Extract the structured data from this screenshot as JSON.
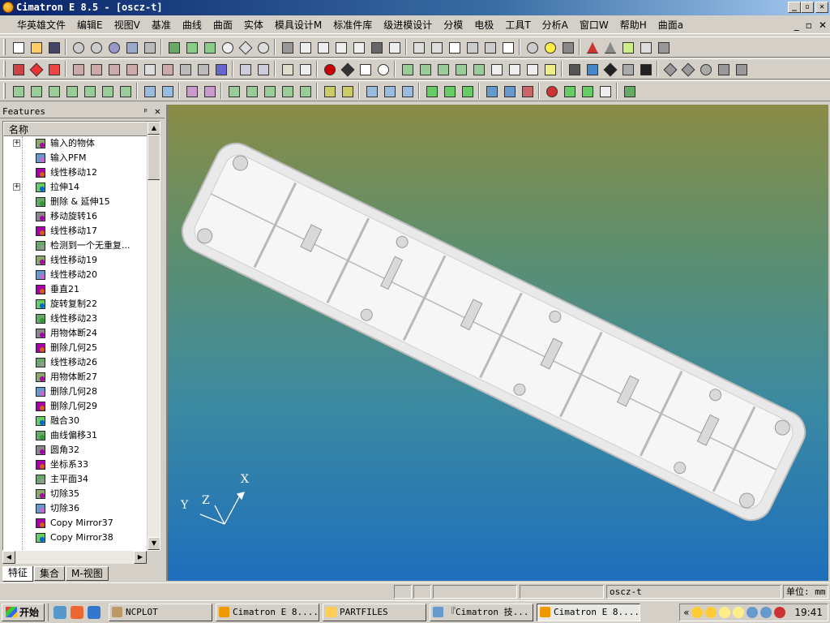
{
  "window": {
    "title": "Cimatron E 8.5 - [oscz-t]",
    "controls": [
      "_",
      "▫",
      "✕"
    ]
  },
  "menu": {
    "items": [
      "华英雄文件",
      "编辑E",
      "视图V",
      "基准",
      "曲线",
      "曲面",
      "实体",
      "模具设计M",
      "标准件库",
      "级进模设计",
      "分模",
      "电极",
      "工具T",
      "分析A",
      "窗口W",
      "帮助H",
      "曲面a"
    ],
    "mdi_controls": [
      "_",
      "▫",
      "✕"
    ]
  },
  "panel": {
    "title": "Features",
    "pin": "ᵖ",
    "close": "✕",
    "column_header": "名称"
  },
  "features": [
    {
      "label": "输入的物体",
      "expandable": true
    },
    {
      "label": "输入PFM"
    },
    {
      "label": "线性移动12"
    },
    {
      "label": "拉伸14",
      "expandable": true
    },
    {
      "label": "删除 & 延伸15"
    },
    {
      "label": "移动旋转16"
    },
    {
      "label": "线性移动17"
    },
    {
      "label": "检测到一个无重复..."
    },
    {
      "label": "线性移动19"
    },
    {
      "label": "线性移动20"
    },
    {
      "label": "垂直21"
    },
    {
      "label": "旋转复制22"
    },
    {
      "label": "线性移动23"
    },
    {
      "label": "用物体断24"
    },
    {
      "label": "删除几何25"
    },
    {
      "label": "线性移动26"
    },
    {
      "label": "用物体断27"
    },
    {
      "label": "删除几何28"
    },
    {
      "label": "删除几何29"
    },
    {
      "label": "融合30"
    },
    {
      "label": "曲线偏移31"
    },
    {
      "label": "圆角32"
    },
    {
      "label": "坐标系33"
    },
    {
      "label": "主平面34"
    },
    {
      "label": "切除35"
    },
    {
      "label": "切除36"
    },
    {
      "label": "Copy Mirror37"
    },
    {
      "label": "Copy Mirror38"
    }
  ],
  "panel_tabs": [
    "特征",
    "集合",
    "M-视图"
  ],
  "axes": {
    "x": "X",
    "y": "Y",
    "z": "Z"
  },
  "status": {
    "file": "oscz-t",
    "units": "单位: mm"
  },
  "taskbar": {
    "start": "开始",
    "tasks": [
      "NCPLOT",
      "Cimatron E 8....",
      "PARTFILES",
      "『Cimatron 技...",
      "Cimatron E 8...."
    ],
    "tray_chevron": "«",
    "clock": "19:41"
  },
  "colors": {
    "title_start": "#0a246a",
    "viewport_top": "#8a8c45",
    "viewport_bottom": "#1e6fbd"
  }
}
